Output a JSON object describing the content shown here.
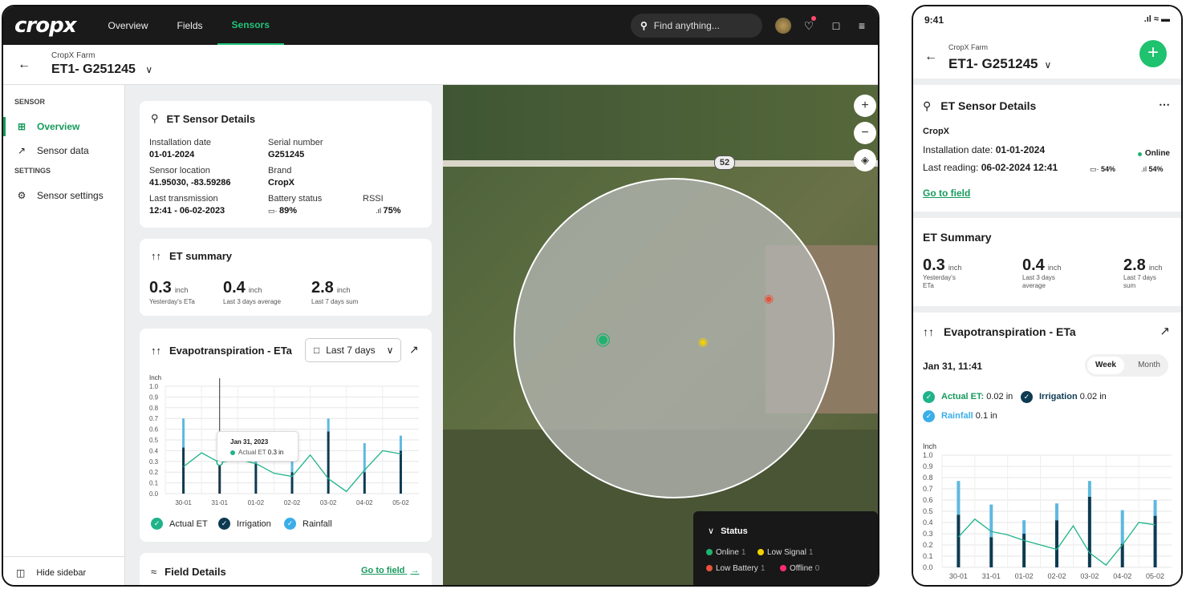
{
  "app": {
    "logo": "cropx",
    "nav": [
      "Overview",
      "Fields",
      "Sensors"
    ],
    "search_placeholder": "Find anything...",
    "breadcrumb_farm": "CropX Farm",
    "sensor_id": "ET1- G251245"
  },
  "sidebar": {
    "section_sensor": "SENSOR",
    "overview": "Overview",
    "sensor_data": "Sensor data",
    "section_settings": "SETTINGS",
    "sensor_settings": "Sensor settings",
    "hide": "Hide sidebar"
  },
  "details": {
    "title": "ET Sensor Details",
    "installation_label": "Installation date",
    "installation_value": "01-01-2024",
    "serial_label": "Serial number",
    "serial_value": "G251245",
    "location_label": "Sensor location",
    "location_value": "41.95030, -83.59286",
    "brand_label": "Brand",
    "brand_value": "CropX",
    "transmission_label": "Last transmission",
    "transmission_value": "12:41 - 06-02-2023",
    "battery_label": "Battery status",
    "battery_value": "89%",
    "rssi_label": "RSSI",
    "rssi_value": "75%"
  },
  "summary": {
    "title": "ET summary",
    "items": [
      {
        "value": "0.3",
        "unit": "inch",
        "caption": "Yesterday's ETa"
      },
      {
        "value": "0.4",
        "unit": "inch",
        "caption": "Last 3 days average"
      },
      {
        "value": "2.8",
        "unit": "inch",
        "caption": "Last 7 days sum"
      }
    ]
  },
  "evap": {
    "title": "Evapotranspiration - ETa",
    "range": "Last 7 days",
    "tooltip_date": "Jan 31, 2023",
    "tooltip_label": "Actual ET",
    "tooltip_value": "0.3 in",
    "legend": [
      "Actual ET",
      "Irrigation",
      "Rainfall"
    ]
  },
  "field": {
    "title": "Field Details",
    "link": "Go to field"
  },
  "map": {
    "road_number": "52",
    "status_title": "Status",
    "online": "Online",
    "online_n": "1",
    "low_signal": "Low Signal",
    "low_signal_n": "1",
    "low_battery": "Low Battery",
    "low_battery_n": "1",
    "offline": "Offline",
    "offline_n": "0"
  },
  "colors": {
    "accent": "#23c27a",
    "actual": "#1fb38a",
    "irrigation": "#0d3a52",
    "rainfall": "#5fb8e0"
  },
  "mobile": {
    "time": "9:41",
    "farm": "CropX Farm",
    "sensor_id": "ET1- G251245",
    "details_title": "ET Sensor Details",
    "brand": "CropX",
    "installation_label": "Installation date:",
    "installation_value": "01-01-2024",
    "status": "Online",
    "reading_label": "Last reading:",
    "reading_value": "06-02-2024 12:41",
    "battery": "54%",
    "signal": "54%",
    "go_to_field": "Go to field",
    "summary_title": "ET Summary",
    "summary": [
      {
        "value": "0.3",
        "unit": "inch",
        "caption1": "Yesterday's",
        "caption2": "ETa"
      },
      {
        "value": "0.4",
        "unit": "inch",
        "caption1": "Last 3 days",
        "caption2": "average"
      },
      {
        "value": "2.8",
        "unit": "inch",
        "caption1": "Last 7 days",
        "caption2": "sum"
      }
    ],
    "evap_title": "Evapotranspiration - ETa",
    "date": "Jan 31, 11:41",
    "week": "Week",
    "month": "Month",
    "actual_label": "Actual ET:",
    "actual_value": "0.02 in",
    "irrigation_label": "Irrigation",
    "irrigation_value": "0.02 in",
    "rainfall_label": "Rainfall",
    "rainfall_value": "0.1 in"
  },
  "chart_data": [
    {
      "type": "bar",
      "ylabel": "Inch",
      "ylim": [
        0,
        1.0
      ],
      "yticks": [
        "0.0",
        "0.1",
        "0.2",
        "0.3",
        "0.4",
        "0.5",
        "0.6",
        "0.7",
        "0.8",
        "0.9",
        "1.0"
      ],
      "categories": [
        "30-01",
        "31-01",
        "01-02",
        "02-02",
        "03-02",
        "04-02",
        "05-02"
      ],
      "series": [
        {
          "name": "Irrigation",
          "type": "bar",
          "x": [
            0,
            1,
            2,
            3,
            4,
            5,
            6
          ],
          "values": [
            0.43,
            0.28,
            0.28,
            0.2,
            0.58,
            0.2,
            0.4
          ]
        },
        {
          "name": "Rainfall",
          "type": "bar",
          "x": [
            0,
            1,
            2,
            3,
            4,
            5,
            6
          ],
          "values": [
            0.27,
            0.24,
            0.02,
            0.33,
            0.12,
            0.27,
            0.14
          ]
        },
        {
          "name": "Actual ET",
          "type": "line",
          "x": [
            0,
            0.5,
            1,
            1.5,
            2,
            2.5,
            3,
            3.5,
            4,
            4.5,
            5,
            5.5,
            6
          ],
          "values": [
            0.25,
            0.38,
            0.29,
            0.32,
            0.28,
            0.19,
            0.16,
            0.36,
            0.14,
            0.02,
            0.22,
            0.4,
            0.37
          ]
        }
      ]
    },
    {
      "type": "bar",
      "ylabel": "Inch",
      "ylim": [
        0,
        1.0
      ],
      "yticks": [
        "0.0",
        "0.1",
        "0.2",
        "0.3",
        "0.4",
        "0.5",
        "0.6",
        "0.7",
        "0.8",
        "0.9",
        "1.0"
      ],
      "categories": [
        "30-01",
        "31-01",
        "01-02",
        "02-02",
        "03-02",
        "04-02",
        "05-02"
      ],
      "series": [
        {
          "name": "Irrigation",
          "type": "bar",
          "x": [
            0,
            1,
            2,
            3,
            4,
            5,
            6
          ],
          "values": [
            0.47,
            0.27,
            0.3,
            0.42,
            0.63,
            0.21,
            0.46
          ]
        },
        {
          "name": "Rainfall",
          "type": "bar",
          "x": [
            0,
            1,
            2,
            3,
            4,
            5,
            6
          ],
          "values": [
            0.3,
            0.29,
            0.12,
            0.15,
            0.14,
            0.3,
            0.14
          ]
        },
        {
          "name": "Actual ET",
          "type": "line",
          "x": [
            0,
            0.5,
            1,
            1.5,
            2,
            2.5,
            3,
            3.5,
            4,
            4.5,
            5,
            5.5,
            6
          ],
          "values": [
            0.27,
            0.43,
            0.32,
            0.29,
            0.24,
            0.2,
            0.16,
            0.37,
            0.13,
            0.02,
            0.2,
            0.4,
            0.38
          ]
        }
      ]
    }
  ]
}
